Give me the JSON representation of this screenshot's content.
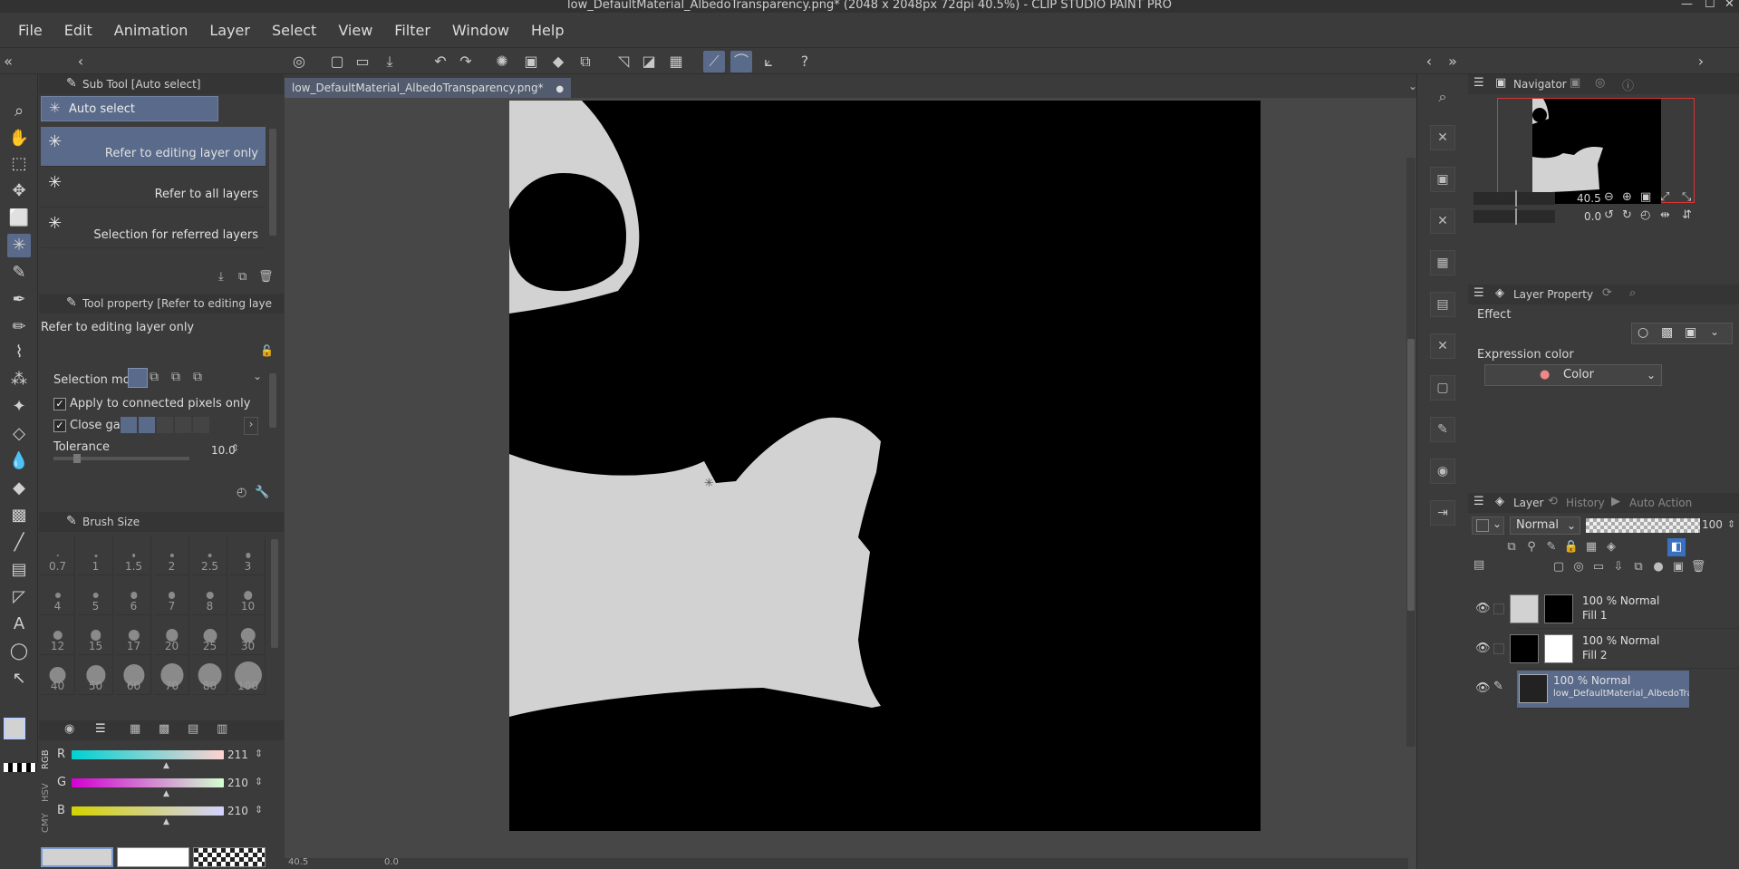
{
  "window": {
    "title": "low_DefaultMaterial_AlbedoTransparency.png* (2048 x 2048px 72dpi 40.5%)  - CLIP STUDIO PAINT PRO"
  },
  "menu": [
    "File",
    "Edit",
    "Animation",
    "Layer",
    "Select",
    "View",
    "Filter",
    "Window",
    "Help"
  ],
  "subtool": {
    "header": "Sub Tool [Auto select]",
    "group": "Auto select",
    "items": [
      "Refer to editing layer only",
      "Refer to all layers",
      "Selection for referred layers"
    ]
  },
  "toolprop": {
    "header": "Tool property [Refer to editing layer o",
    "preset_name": "Refer to editing layer only",
    "selection_mode_label": "Selection mode",
    "apply_connected_label": "Apply to connected pixels only",
    "close_gap_label": "Close gap",
    "tolerance_label": "Tolerance",
    "tolerance_value": "10.0"
  },
  "brushsize": {
    "header": "Brush Size",
    "sizes": [
      "0.7",
      "1",
      "1.5",
      "2",
      "2.5",
      "3",
      "4",
      "5",
      "6",
      "7",
      "8",
      "10",
      "12",
      "15",
      "17",
      "20",
      "25",
      "30",
      "40",
      "50",
      "60",
      "70",
      "80",
      "100"
    ]
  },
  "color": {
    "tabs": [
      "RGB",
      "HSV",
      "CMY"
    ],
    "r_label": "R",
    "r_value": "211",
    "g_label": "G",
    "g_value": "210",
    "b_label": "B",
    "b_value": "210",
    "main_color": "#d3d2d2",
    "sub_color": "#ffffff"
  },
  "document": {
    "tab_title": "low_DefaultMaterial_AlbedoTransparency.png*",
    "zoom_status": "40.5",
    "rotation_status": "0.0"
  },
  "navigator": {
    "header": "Navigator",
    "zoom_value": "40.5",
    "rotate_value": "0.0"
  },
  "layer_property": {
    "header": "Layer Property",
    "effect_label": "Effect",
    "expression_label": "Expression color",
    "expression_value": "Color"
  },
  "layer_panel": {
    "tabs": [
      "Layer",
      "History",
      "Auto Action"
    ],
    "blend_mode": "Normal",
    "opacity": "100",
    "layers": [
      {
        "mode": "100 % Normal",
        "name": "Fill 1"
      },
      {
        "mode": "100 % Normal",
        "name": "Fill 2"
      },
      {
        "mode": "100 % Normal",
        "name": "low_DefaultMaterial_AlbedoTransparenc"
      }
    ]
  },
  "colors": {
    "selection": "#5a6a8a",
    "panel_bg": "#3b3b3b",
    "canvas_bg": "#474747",
    "art_shape": "#d3d2d2"
  }
}
